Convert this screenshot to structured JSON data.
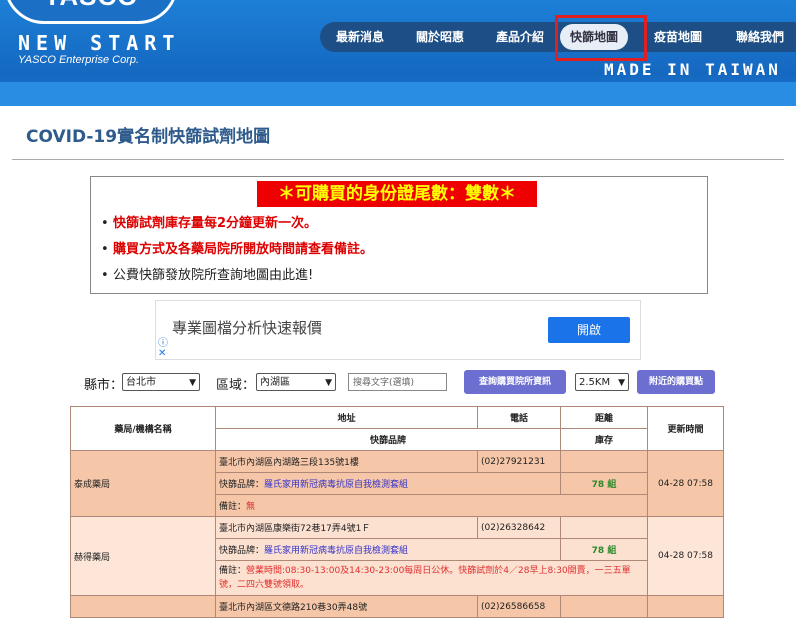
{
  "header": {
    "logo_text": "YASCO",
    "brand_title": "NEW START",
    "brand_subtitle": "YASCO Enterprise Corp.",
    "tagline": "MADE IN TAIWAN",
    "nav": [
      "最新消息",
      "關於昭惠",
      "產品介紹",
      "快篩地圖",
      "疫苗地圖",
      "聯絡我們"
    ],
    "active_nav": "快篩地圖"
  },
  "page_title": "COVID-19實名制快篩試劑地圖",
  "notice": {
    "banner": "＊可購買的身份證尾數：雙數＊",
    "items": [
      "快篩試劑庫存量每2分鐘更新一次。",
      "購買方式及各藥局院所開放時間請查看備註。",
      "公費快篩發放院所查詢地圖由此進!"
    ]
  },
  "ad": {
    "text": "專業圖檔分析快速報價",
    "button": "開啟"
  },
  "filters": {
    "county_label": "縣市：",
    "county_value": "台北市",
    "district_label": "區域：",
    "district_value": "內湖區",
    "search_placeholder": "搜尋文字(選填)",
    "query_button": "查詢購買院所資訊",
    "distance_value": "2.5KM",
    "nearby_button": "附近的購買點"
  },
  "table": {
    "headers": {
      "name": "藥局/機構名稱",
      "address": "地址",
      "phone": "電話",
      "distance": "距離",
      "brand": "快篩品牌",
      "stock": "庫存",
      "updated": "更新時間"
    },
    "rows": [
      {
        "name": "泰成藥局",
        "address": "臺北市內湖區內湖路三段135號1樓",
        "phone": "(02)27921231",
        "distance": "",
        "brand_label": "快篩品牌：",
        "brand": "羅氏家用新冠病毒抗原自我檢測套組",
        "stock": "78 組",
        "note_label": "備註：",
        "note": "無",
        "updated": "04-28 07:58"
      },
      {
        "name": "赫得藥局",
        "address": "臺北市內湖區康樂街72巷17弄4號1Ｆ",
        "phone": "(02)26328642",
        "distance": "",
        "brand_label": "快篩品牌：",
        "brand": "羅氏家用新冠病毒抗原自我檢測套組",
        "stock": "78 組",
        "note_label": "備註：",
        "note": "營業時間:08:30-13:00及14:30-23:00每周日公休。快篩試劑於4／28早上8:30開賣，一三五單號，二四六雙號領取。",
        "updated": "04-28 07:58"
      },
      {
        "address": "臺北市內湖區文德路210巷30弄48號",
        "phone": "(02)26586658"
      }
    ]
  }
}
